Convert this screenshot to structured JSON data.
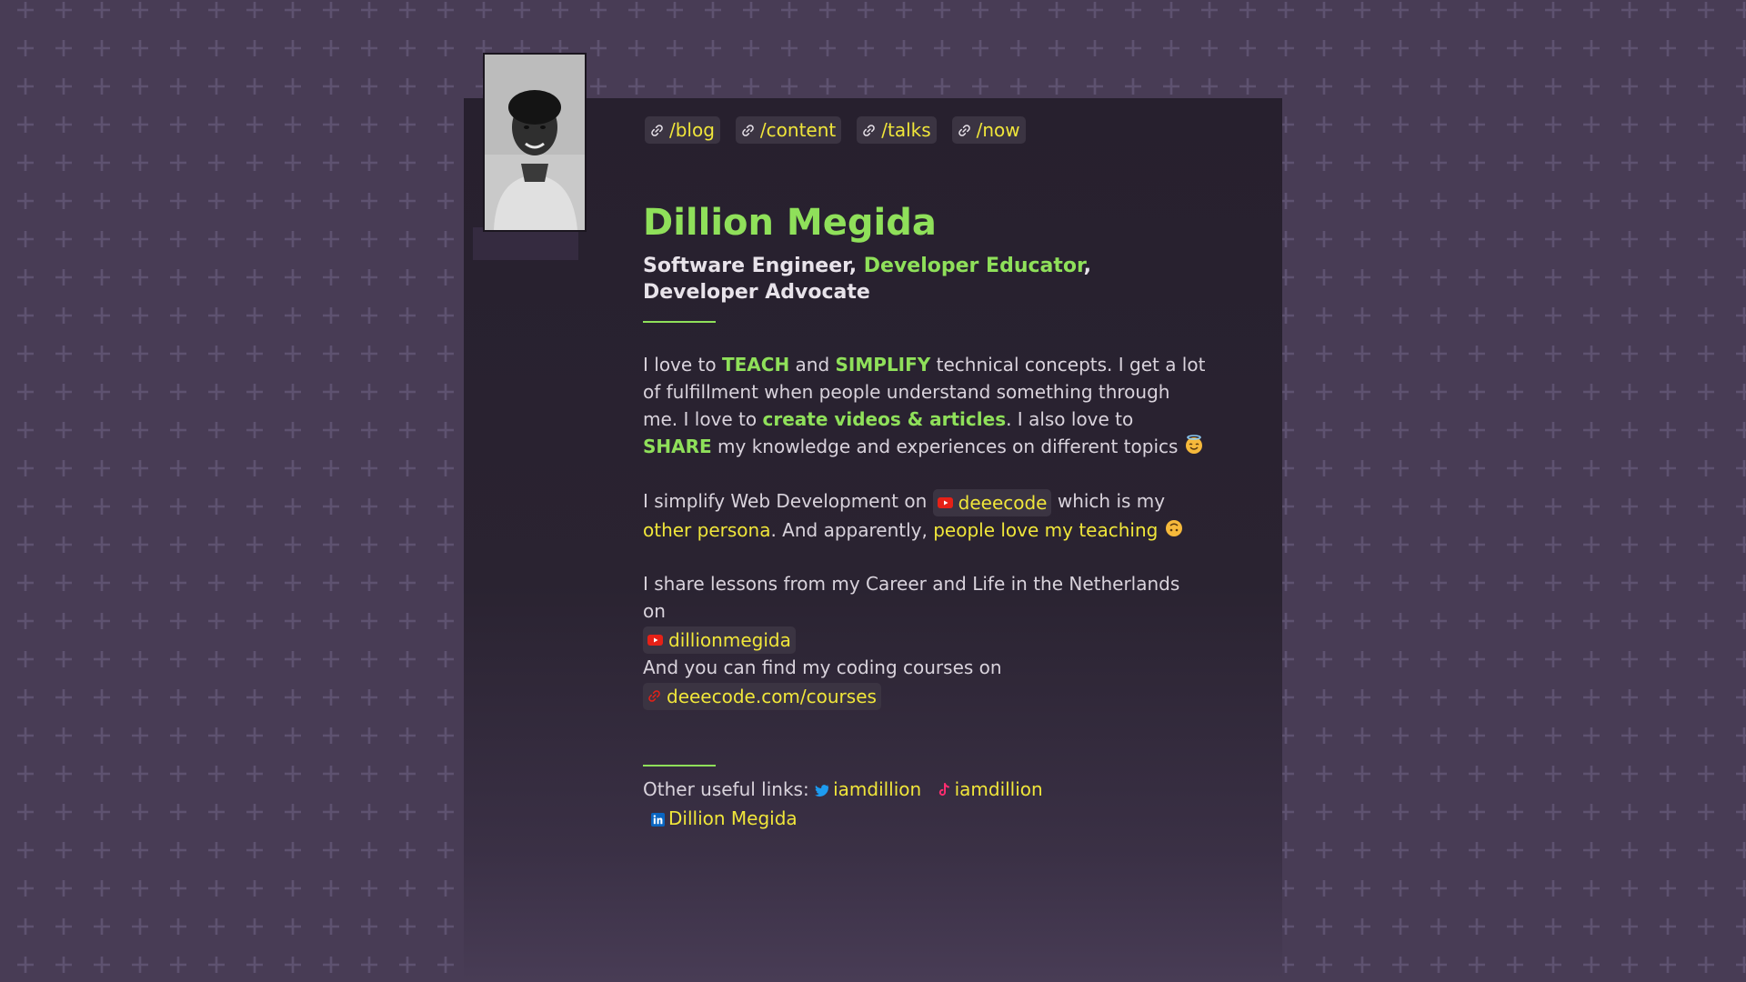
{
  "nav": [
    {
      "label": "/blog"
    },
    {
      "label": "/content"
    },
    {
      "label": "/talks"
    },
    {
      "label": "/now"
    }
  ],
  "profile": {
    "name": "Dillion Megida",
    "role_1": "Software Engineer,",
    "role_2": "Developer Educator",
    "role_sep": ",",
    "role_3": "Developer Advocate"
  },
  "intro": {
    "t1": "I love to ",
    "teach": "TEACH",
    "t2": " and ",
    "simplify": "SIMPLIFY",
    "t3": " technical concepts. I get a lot of fulfillment when people understand something through me. I love to ",
    "create": "create videos & articles",
    "t4": ". I also love to ",
    "share": "SHARE",
    "t5": " my knowledge and experiences on different topics"
  },
  "webdev": {
    "t1": "I simplify Web Development on",
    "channel": "deeecode",
    "t2": "which is my",
    "persona": "other persona",
    "t3": ". And apparently,",
    "love": "people love my teaching"
  },
  "career": {
    "t1": "I share lessons from my Career and Life in the Netherlands on",
    "channel": "dillionmegida"
  },
  "courses": {
    "t1": "And you can find my coding courses on",
    "link": "deeecode.com/courses"
  },
  "footer": {
    "label": "Other useful links:",
    "twitter": "iamdillion",
    "tiktok": "iamdillion",
    "linkedin": "Dillion Megida"
  },
  "colors": {
    "background": "#483c55",
    "card": "#27202e",
    "accent_green": "#8fe05a",
    "link_yellow": "#f0e63a",
    "youtube_red": "#e62117",
    "twitter_blue": "#1d9bf0",
    "tiktok_pink": "#ff2d6f",
    "linkedin_blue": "#0a66c2"
  },
  "icons": {
    "nav": "link-icon",
    "channels": "youtube-icon",
    "courses": "link-icon",
    "socials": [
      "twitter-icon",
      "tiktok-icon",
      "linkedin-icon"
    ],
    "emoji_1": "smiling-face-with-halo",
    "emoji_2": "upside-down-face"
  }
}
